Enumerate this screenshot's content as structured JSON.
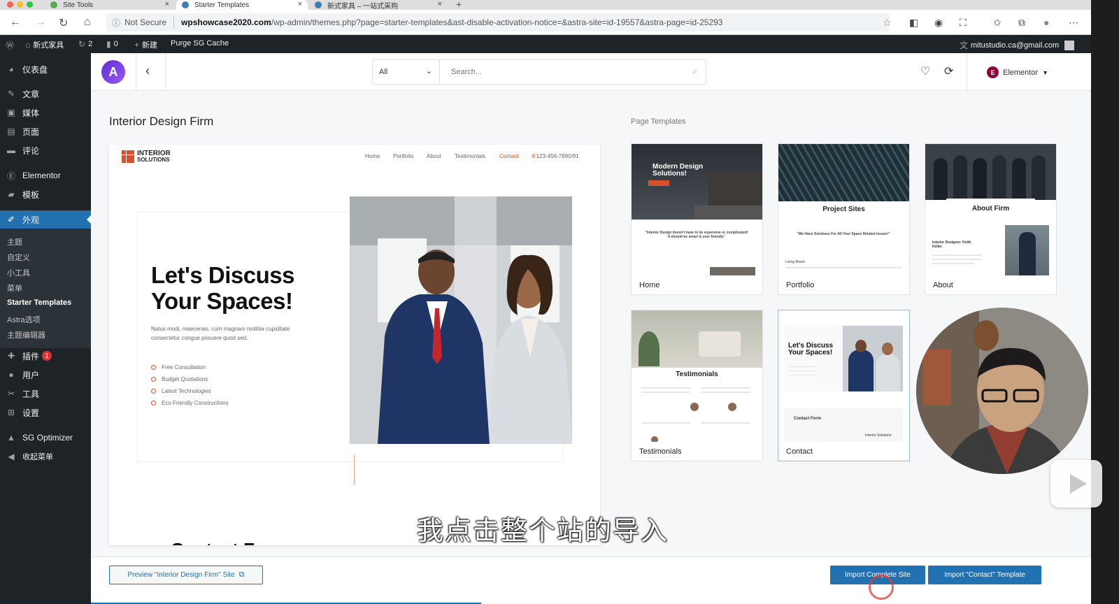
{
  "browser": {
    "tabs": [
      {
        "title": "Site Tools"
      },
      {
        "title": "Starter Templates"
      },
      {
        "title": "新式家具 – 一站式采购"
      }
    ],
    "security": "Not Secure",
    "url_host": "wpshowcase2020.com",
    "url_path": "/wp-admin/themes.php?page=starter-templates&ast-disable-activation-notice=&astra-site=id-19557&astra-page=id-25293"
  },
  "adminbar": {
    "site_name": "新式家具",
    "updates": "2",
    "comments": "0",
    "new": "新建",
    "purge": "Purge SG Cache",
    "user": "mitustudio.ca@gmail.com"
  },
  "sidebar": {
    "items": [
      {
        "label": "仪表盘",
        "icon": "dashboard-icon"
      },
      {
        "label": "文章",
        "icon": "pin-icon"
      },
      {
        "label": "媒体",
        "icon": "media-icon"
      },
      {
        "label": "页面",
        "icon": "page-icon"
      },
      {
        "label": "评论",
        "icon": "comment-icon"
      },
      {
        "label": "Elementor",
        "icon": "elementor-icon"
      },
      {
        "label": "模板",
        "icon": "folder-icon"
      },
      {
        "label": "外观",
        "icon": "brush-icon"
      },
      {
        "label": "插件",
        "icon": "plugin-icon",
        "badge": "1"
      },
      {
        "label": "用户",
        "icon": "user-icon"
      },
      {
        "label": "工具",
        "icon": "wrench-icon"
      },
      {
        "label": "设置",
        "icon": "settings-icon"
      },
      {
        "label": "SG Optimizer",
        "icon": "sg-icon"
      },
      {
        "label": "收起菜单",
        "icon": "collapse-icon"
      }
    ],
    "submenu": [
      "主题",
      "自定义",
      "小工具",
      "菜单",
      "Starter Templates",
      "Astra选项",
      "主题编辑器"
    ]
  },
  "topbar": {
    "filter": "All",
    "search_placeholder": "Search...",
    "builder": "Elementor"
  },
  "main": {
    "site_title": "Interior Design Firm",
    "page_templates_label": "Page Templates"
  },
  "preview": {
    "logo_line1": "INTERIOR",
    "logo_line2": "SOLUTIONS",
    "nav": [
      "Home",
      "Portfolio",
      "About",
      "Testimonials",
      "Contact"
    ],
    "phone": "123-456-7890/91",
    "hero_line1": "Let's Discuss",
    "hero_line2": "Your Spaces!",
    "sub": "Natus modi, maecenas, cum magnam mollitia cupiditate consectetur congue posuere quod sed.",
    "list": [
      "Free Consultation",
      "Budget Quotations",
      "Latest Technologies",
      "Eco Friendly Constructions"
    ],
    "bottom_heading": "Contact F"
  },
  "templates": [
    {
      "label": "Home",
      "thumb_title": "Modern Design Solutions!",
      "thumb_quote": "\"Interior Design doesn't have to be expensive or complicated! It should be smart & user friendly\""
    },
    {
      "label": "Portfolio",
      "thumb_title": "Project Sites",
      "thumb_quote": "\"We Have Solutions For All Your Space Related Issues!\"",
      "thumb_caption": "Living Room"
    },
    {
      "label": "About",
      "thumb_title": "About Firm",
      "thumb_caption": "Interior Designer: Keith Keller"
    },
    {
      "label": "Testimonials",
      "thumb_title": "Testimonials"
    },
    {
      "label": "Contact",
      "thumb_title": "Let's Discuss Your Spaces!",
      "thumb_caption": "Contact Form",
      "thumb_caption2": "Interior Solutions"
    }
  ],
  "bottombar": {
    "preview_btn": "Preview \"Interior Design Firm\" Site",
    "import_site_btn": "Import Complete Site",
    "import_template_btn": "Import \"Contact\" Template",
    "progress": 0.39
  },
  "overlay": {
    "subtitle": "我点击整个站的导入"
  },
  "colors": {
    "wp_dark": "#1d2327",
    "wp_blue": "#2271b1",
    "brand_orange": "#d9512c",
    "astra_purple": "#6b3ae0"
  }
}
